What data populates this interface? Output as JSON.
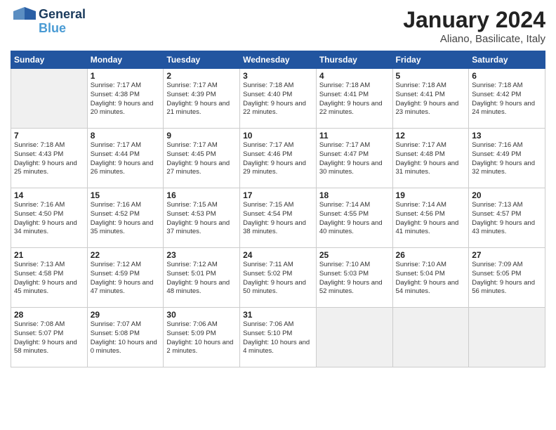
{
  "header": {
    "logo_line1": "General",
    "logo_line2": "Blue",
    "month": "January 2024",
    "location": "Aliano, Basilicate, Italy"
  },
  "days_of_week": [
    "Sunday",
    "Monday",
    "Tuesday",
    "Wednesday",
    "Thursday",
    "Friday",
    "Saturday"
  ],
  "weeks": [
    [
      {
        "num": "",
        "empty": true
      },
      {
        "num": "1",
        "sunrise": "Sunrise: 7:17 AM",
        "sunset": "Sunset: 4:38 PM",
        "daylight": "Daylight: 9 hours and 20 minutes."
      },
      {
        "num": "2",
        "sunrise": "Sunrise: 7:17 AM",
        "sunset": "Sunset: 4:39 PM",
        "daylight": "Daylight: 9 hours and 21 minutes."
      },
      {
        "num": "3",
        "sunrise": "Sunrise: 7:18 AM",
        "sunset": "Sunset: 4:40 PM",
        "daylight": "Daylight: 9 hours and 22 minutes."
      },
      {
        "num": "4",
        "sunrise": "Sunrise: 7:18 AM",
        "sunset": "Sunset: 4:41 PM",
        "daylight": "Daylight: 9 hours and 22 minutes."
      },
      {
        "num": "5",
        "sunrise": "Sunrise: 7:18 AM",
        "sunset": "Sunset: 4:41 PM",
        "daylight": "Daylight: 9 hours and 23 minutes."
      },
      {
        "num": "6",
        "sunrise": "Sunrise: 7:18 AM",
        "sunset": "Sunset: 4:42 PM",
        "daylight": "Daylight: 9 hours and 24 minutes."
      }
    ],
    [
      {
        "num": "7",
        "sunrise": "Sunrise: 7:18 AM",
        "sunset": "Sunset: 4:43 PM",
        "daylight": "Daylight: 9 hours and 25 minutes."
      },
      {
        "num": "8",
        "sunrise": "Sunrise: 7:17 AM",
        "sunset": "Sunset: 4:44 PM",
        "daylight": "Daylight: 9 hours and 26 minutes."
      },
      {
        "num": "9",
        "sunrise": "Sunrise: 7:17 AM",
        "sunset": "Sunset: 4:45 PM",
        "daylight": "Daylight: 9 hours and 27 minutes."
      },
      {
        "num": "10",
        "sunrise": "Sunrise: 7:17 AM",
        "sunset": "Sunset: 4:46 PM",
        "daylight": "Daylight: 9 hours and 29 minutes."
      },
      {
        "num": "11",
        "sunrise": "Sunrise: 7:17 AM",
        "sunset": "Sunset: 4:47 PM",
        "daylight": "Daylight: 9 hours and 30 minutes."
      },
      {
        "num": "12",
        "sunrise": "Sunrise: 7:17 AM",
        "sunset": "Sunset: 4:48 PM",
        "daylight": "Daylight: 9 hours and 31 minutes."
      },
      {
        "num": "13",
        "sunrise": "Sunrise: 7:16 AM",
        "sunset": "Sunset: 4:49 PM",
        "daylight": "Daylight: 9 hours and 32 minutes."
      }
    ],
    [
      {
        "num": "14",
        "sunrise": "Sunrise: 7:16 AM",
        "sunset": "Sunset: 4:50 PM",
        "daylight": "Daylight: 9 hours and 34 minutes."
      },
      {
        "num": "15",
        "sunrise": "Sunrise: 7:16 AM",
        "sunset": "Sunset: 4:52 PM",
        "daylight": "Daylight: 9 hours and 35 minutes."
      },
      {
        "num": "16",
        "sunrise": "Sunrise: 7:15 AM",
        "sunset": "Sunset: 4:53 PM",
        "daylight": "Daylight: 9 hours and 37 minutes."
      },
      {
        "num": "17",
        "sunrise": "Sunrise: 7:15 AM",
        "sunset": "Sunset: 4:54 PM",
        "daylight": "Daylight: 9 hours and 38 minutes."
      },
      {
        "num": "18",
        "sunrise": "Sunrise: 7:14 AM",
        "sunset": "Sunset: 4:55 PM",
        "daylight": "Daylight: 9 hours and 40 minutes."
      },
      {
        "num": "19",
        "sunrise": "Sunrise: 7:14 AM",
        "sunset": "Sunset: 4:56 PM",
        "daylight": "Daylight: 9 hours and 41 minutes."
      },
      {
        "num": "20",
        "sunrise": "Sunrise: 7:13 AM",
        "sunset": "Sunset: 4:57 PM",
        "daylight": "Daylight: 9 hours and 43 minutes."
      }
    ],
    [
      {
        "num": "21",
        "sunrise": "Sunrise: 7:13 AM",
        "sunset": "Sunset: 4:58 PM",
        "daylight": "Daylight: 9 hours and 45 minutes."
      },
      {
        "num": "22",
        "sunrise": "Sunrise: 7:12 AM",
        "sunset": "Sunset: 4:59 PM",
        "daylight": "Daylight: 9 hours and 47 minutes."
      },
      {
        "num": "23",
        "sunrise": "Sunrise: 7:12 AM",
        "sunset": "Sunset: 5:01 PM",
        "daylight": "Daylight: 9 hours and 48 minutes."
      },
      {
        "num": "24",
        "sunrise": "Sunrise: 7:11 AM",
        "sunset": "Sunset: 5:02 PM",
        "daylight": "Daylight: 9 hours and 50 minutes."
      },
      {
        "num": "25",
        "sunrise": "Sunrise: 7:10 AM",
        "sunset": "Sunset: 5:03 PM",
        "daylight": "Daylight: 9 hours and 52 minutes."
      },
      {
        "num": "26",
        "sunrise": "Sunrise: 7:10 AM",
        "sunset": "Sunset: 5:04 PM",
        "daylight": "Daylight: 9 hours and 54 minutes."
      },
      {
        "num": "27",
        "sunrise": "Sunrise: 7:09 AM",
        "sunset": "Sunset: 5:05 PM",
        "daylight": "Daylight: 9 hours and 56 minutes."
      }
    ],
    [
      {
        "num": "28",
        "sunrise": "Sunrise: 7:08 AM",
        "sunset": "Sunset: 5:07 PM",
        "daylight": "Daylight: 9 hours and 58 minutes."
      },
      {
        "num": "29",
        "sunrise": "Sunrise: 7:07 AM",
        "sunset": "Sunset: 5:08 PM",
        "daylight": "Daylight: 10 hours and 0 minutes."
      },
      {
        "num": "30",
        "sunrise": "Sunrise: 7:06 AM",
        "sunset": "Sunset: 5:09 PM",
        "daylight": "Daylight: 10 hours and 2 minutes."
      },
      {
        "num": "31",
        "sunrise": "Sunrise: 7:06 AM",
        "sunset": "Sunset: 5:10 PM",
        "daylight": "Daylight: 10 hours and 4 minutes."
      },
      {
        "num": "",
        "empty": true
      },
      {
        "num": "",
        "empty": true
      },
      {
        "num": "",
        "empty": true
      }
    ]
  ]
}
